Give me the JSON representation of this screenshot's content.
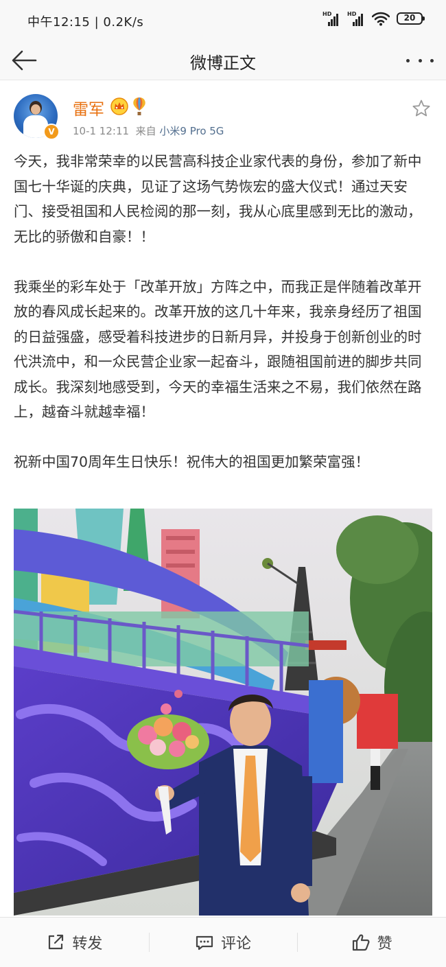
{
  "status_bar": {
    "time": "中午12:15",
    "network_speed": "0.2K/s",
    "signal1_label": "HD",
    "signal2_label": "HD",
    "battery": "20"
  },
  "nav": {
    "title": "微博正文",
    "back_icon": "arrow-left-icon",
    "more_icon": "more-dots-icon"
  },
  "post": {
    "author": "雷军",
    "author_color": "#e8700f",
    "verified_badge": "V",
    "date": "10-1 12:11",
    "from_label": "来自",
    "source": "小米9 Pro 5G",
    "paragraphs": [
      "今天，我非常荣幸的以民营高科技企业家代表的身份，参加了新中国七十华诞的庆典，见证了这场气势恢宏的盛大仪式！通过天安门、接受祖国和人民检阅的那一刻，我从心底里感到无比的激动，无比的骄傲和自豪！！",
      "我乘坐的彩车处于「改革开放」方阵之中，而我正是伴随着改革开放的春风成长起来的。改革开放的这几十年来，我亲身经历了祖国的日益强盛，感受着科技进步的日新月异，并投身于创新创业的时代洪流中，和一众民营企业家一起奋斗，跟随祖国前进的脚步共同成长。我深刻地感受到，今天的幸福生活来之不易，我们依然在路上，越奋斗就越幸福！",
      "祝新中国70周年生日快乐！祝伟大的祖国更加繁荣富强！"
    ]
  },
  "toolbar": {
    "repost": "转发",
    "comment": "评论",
    "like": "赞"
  }
}
